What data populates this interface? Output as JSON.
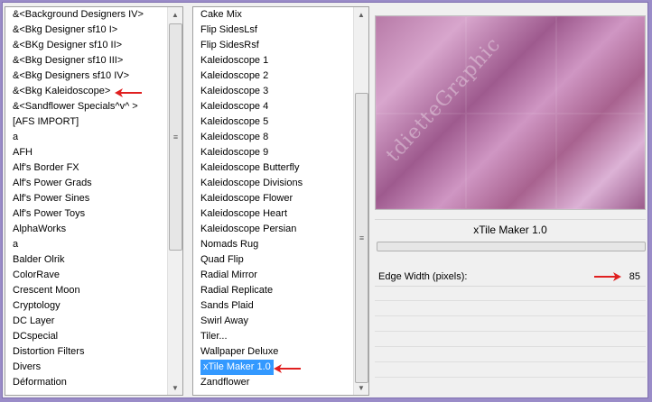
{
  "left_list": {
    "items": [
      "&<Background Designers IV>",
      "&<Bkg Designer sf10 I>",
      "&<BKg Designer sf10 II>",
      "&<Bkg Designer sf10 III>",
      "&<Bkg Designers sf10 IV>",
      "&<Bkg Kaleidoscope>",
      "&<Sandflower Specials^v^ >",
      "[AFS IMPORT]",
      "a",
      "AFH",
      "Alf's Border FX",
      "Alf's Power Grads",
      "Alf's Power Sines",
      "Alf's Power Toys",
      "AlphaWorks",
      "a",
      "Balder Olrik",
      "ColorRave",
      "Crescent Moon",
      "Cryptology",
      "DC Layer",
      "DCspecial",
      "Distortion Filters",
      "Divers",
      "Déformation"
    ]
  },
  "middle_list": {
    "items": [
      "Cake Mix",
      "Flip SidesLsf",
      "Flip SidesRsf",
      "Kaleidoscope 1",
      "Kaleidoscope 2",
      "Kaleidoscope 3",
      "Kaleidoscope 4",
      "Kaleidoscope 5",
      "Kaleidoscope 8",
      "Kaleidoscope 9",
      "Kaleidoscope Butterfly",
      "Kaleidoscope Divisions",
      "Kaleidoscope Flower",
      "Kaleidoscope Heart",
      "Kaleidoscope Persian",
      "Nomads Rug",
      "Quad Flip",
      "Radial Mirror",
      "Radial Replicate",
      "Sands Plaid",
      "Swirl Away",
      "Tiler...",
      "Wallpaper Deluxe",
      "xTile Maker 1.0",
      "Zandflower"
    ],
    "selected": "xTile Maker 1.0"
  },
  "preview": {
    "watermark": "tdietteGraphic"
  },
  "filter": {
    "title": "xTile Maker 1.0",
    "param_label": "Edge Width (pixels):",
    "param_value": "85"
  },
  "colors": {
    "arrow": "#e02020",
    "selection": "#3399ff"
  }
}
